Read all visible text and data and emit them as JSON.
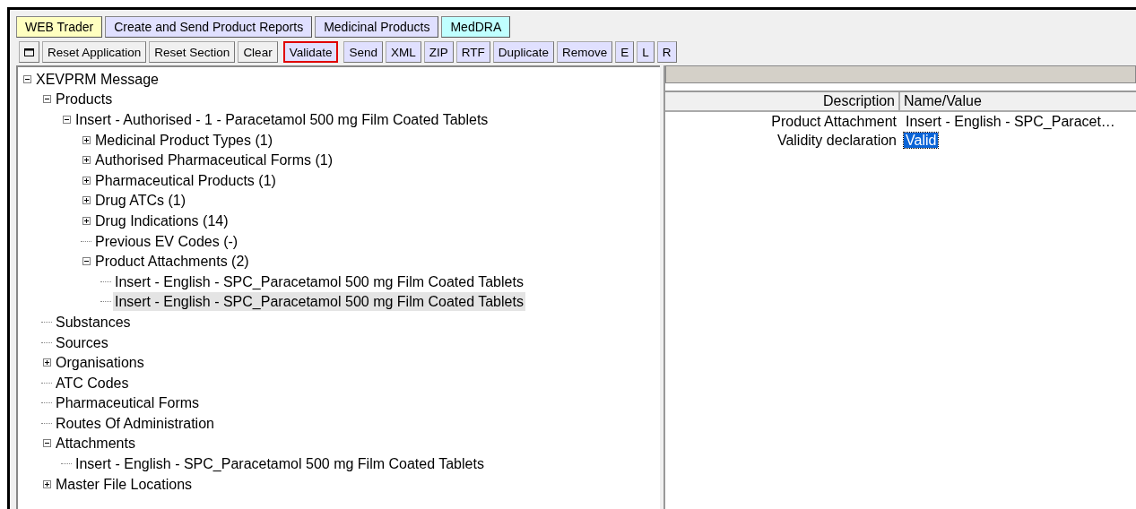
{
  "tabs": [
    {
      "label": "WEB Trader",
      "color": "#ffffc0"
    },
    {
      "label": "Create and Send Product Reports",
      "color": "#e0e0ff"
    },
    {
      "label": "Medicinal Products",
      "color": "#e0e0ff"
    },
    {
      "label": "MedDRA",
      "color": "#c0ffff"
    }
  ],
  "toolbar": [
    {
      "kind": "icon",
      "outlined": false
    },
    {
      "kind": "text",
      "label": "Reset Application",
      "outlined": false
    },
    {
      "kind": "text",
      "label": "Reset Section",
      "outlined": false
    },
    {
      "kind": "text",
      "label": "Clear",
      "outlined": false
    },
    {
      "kind": "text",
      "label": "Validate",
      "outlined": true
    },
    {
      "kind": "text",
      "label": "Send",
      "outlined": false
    },
    {
      "kind": "text",
      "label": "XML",
      "outlined": false
    },
    {
      "kind": "text",
      "label": "ZIP",
      "outlined": false
    },
    {
      "kind": "text",
      "label": "RTF",
      "outlined": false
    },
    {
      "kind": "text",
      "label": "Duplicate",
      "outlined": false
    },
    {
      "kind": "text",
      "label": "Remove",
      "outlined": false
    },
    {
      "kind": "text",
      "label": "E",
      "outlined": false
    },
    {
      "kind": "text",
      "label": "L",
      "outlined": false
    },
    {
      "kind": "text",
      "label": "R",
      "outlined": false
    }
  ],
  "tree": [
    {
      "label": "XEVPRM Message",
      "expanded": true,
      "selected": false,
      "children": [
        {
          "label": "Products",
          "expanded": true,
          "selected": false,
          "children": [
            {
              "label": "Insert - Authorised - 1 - Paracetamol 500 mg Film Coated Tablets",
              "expanded": true,
              "selected": false,
              "children": [
                {
                  "label": "Medicinal Product Types (1)",
                  "expanded": false,
                  "selected": false
                },
                {
                  "label": "Authorised Pharmaceutical Forms (1)",
                  "expanded": false,
                  "selected": false
                },
                {
                  "label": "Pharmaceutical Products (1)",
                  "expanded": false,
                  "selected": false
                },
                {
                  "label": "Drug ATCs (1)",
                  "expanded": false,
                  "selected": false
                },
                {
                  "label": "Drug Indications (14)",
                  "expanded": false,
                  "selected": false
                },
                {
                  "label": "Previous EV Codes (-)",
                  "selected": false
                },
                {
                  "label": "Product Attachments (2)",
                  "expanded": true,
                  "selected": false,
                  "children": [
                    {
                      "label": "Insert - English - SPC_Paracetamol 500 mg Film Coated Tablets",
                      "selected": false
                    },
                    {
                      "label": "Insert - English - SPC_Paracetamol 500 mg Film Coated Tablets",
                      "selected": true
                    }
                  ]
                }
              ]
            }
          ]
        },
        {
          "label": "Substances",
          "selected": false
        },
        {
          "label": "Sources",
          "selected": false
        },
        {
          "label": "Organisations",
          "expanded": false,
          "selected": false
        },
        {
          "label": "ATC Codes",
          "selected": false
        },
        {
          "label": "Pharmaceutical Forms",
          "selected": false
        },
        {
          "label": "Routes Of Administration",
          "selected": false
        },
        {
          "label": "Attachments",
          "expanded": true,
          "selected": false,
          "children": [
            {
              "label": "Insert - English - SPC_Paracetamol 500 mg Film Coated Tablets",
              "selected": false
            }
          ]
        },
        {
          "label": "Master File Locations",
          "expanded": false,
          "selected": false
        }
      ]
    }
  ],
  "properties": {
    "columns": [
      "Description",
      "Name/Value"
    ],
    "rows": [
      {
        "description": "Product Attachment",
        "value": "Insert - English - SPC_Paracet…",
        "selected": false
      },
      {
        "description": "Validity declaration",
        "value": "Valid",
        "selected": true
      }
    ]
  }
}
